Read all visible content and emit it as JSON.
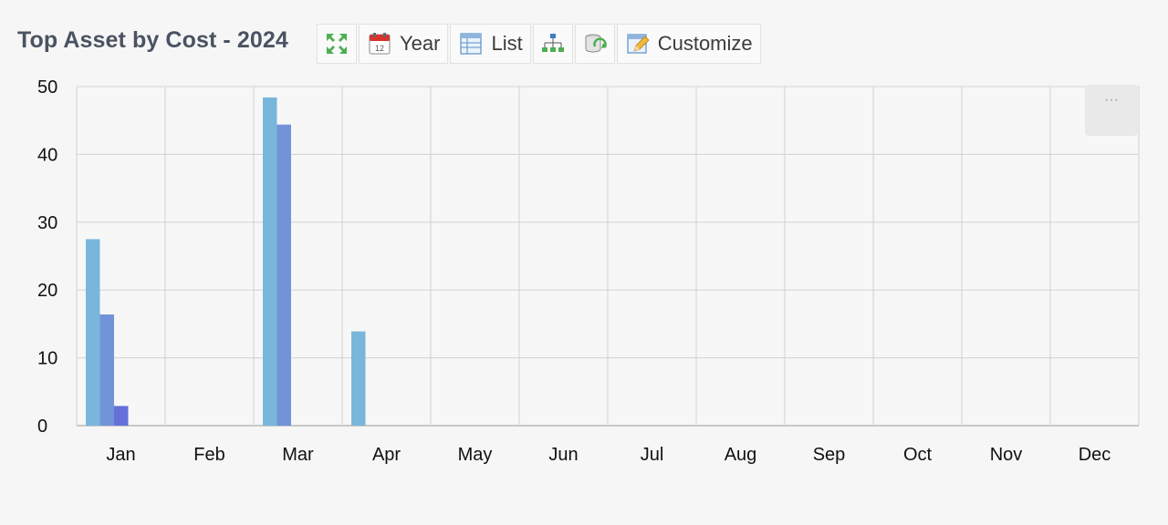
{
  "header": {
    "title": "Top Asset by Cost - 2024"
  },
  "toolbar": {
    "items": [
      {
        "icon": "expand-arrows-icon",
        "label": ""
      },
      {
        "icon": "calendar-icon",
        "label": "Year"
      },
      {
        "icon": "list-icon",
        "label": "List"
      },
      {
        "icon": "hierarchy-icon",
        "label": ""
      },
      {
        "icon": "database-refresh-icon",
        "label": ""
      },
      {
        "icon": "customize-edit-icon",
        "label": "Customize"
      }
    ]
  },
  "menu": {
    "more_label": "···"
  },
  "chart_data": {
    "type": "bar",
    "categories": [
      "Jan",
      "Feb",
      "Mar",
      "Apr",
      "May",
      "Jun",
      "Jul",
      "Aug",
      "Sep",
      "Oct",
      "Nov",
      "Dec"
    ],
    "series": [
      {
        "values": [
          27.5,
          0,
          48.4,
          13.9,
          0,
          0,
          0,
          0,
          0,
          0,
          0,
          0
        ],
        "color": "#78b7db"
      },
      {
        "values": [
          16.4,
          0,
          44.4,
          0,
          0,
          0,
          0,
          0,
          0,
          0,
          0,
          0
        ],
        "color": "#7393d9"
      },
      {
        "values": [
          2.9,
          0,
          0,
          0,
          0,
          0,
          0,
          0,
          0,
          0,
          0,
          0
        ],
        "color": "#6670da"
      }
    ],
    "yticks": [
      0,
      10,
      20,
      30,
      40,
      50
    ],
    "ylim": [
      0,
      50
    ],
    "grid": true,
    "legend": "none",
    "title": "",
    "xlabel": "",
    "ylabel": ""
  }
}
